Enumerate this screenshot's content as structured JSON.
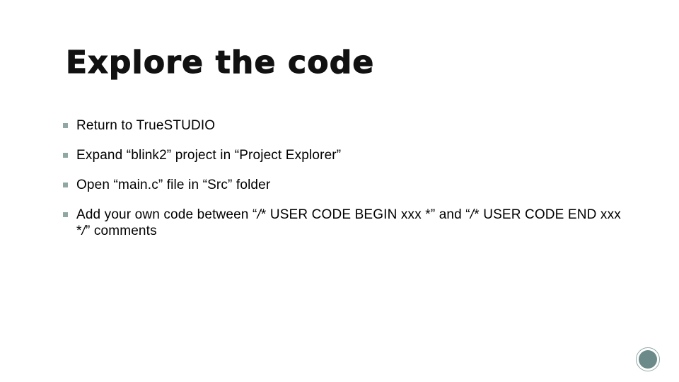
{
  "slide": {
    "title": "Explore the code",
    "background_color": "#ffffff",
    "title_color": "#111111",
    "body_text_color": "#000000",
    "bullet_marker_color": "#8fa8a4",
    "accent_color": "#6d8a8a",
    "bullets": [
      {
        "id": "return-to-truestudio",
        "text": "Return to TrueSTUDIO"
      },
      {
        "id": "expand-blink2-project",
        "text": "Expand “blink2” project in “Project Explorer”"
      },
      {
        "id": "open-main-c",
        "text": "Open “main.c” file in “Src” folder"
      },
      {
        "id": "add-own-code",
        "text_part_1": "Add your own code between “",
        "slash_1": "/",
        "text_part_2": "* USER CODE BEGIN xxx *” and “",
        "slash_2": "/",
        "text_part_3": "* USER CODE END xxx *",
        "slash_3": "/",
        "text_part_4": "” comments"
      }
    ],
    "decoration": {
      "corner_dot_name": "circle-decoration"
    }
  }
}
